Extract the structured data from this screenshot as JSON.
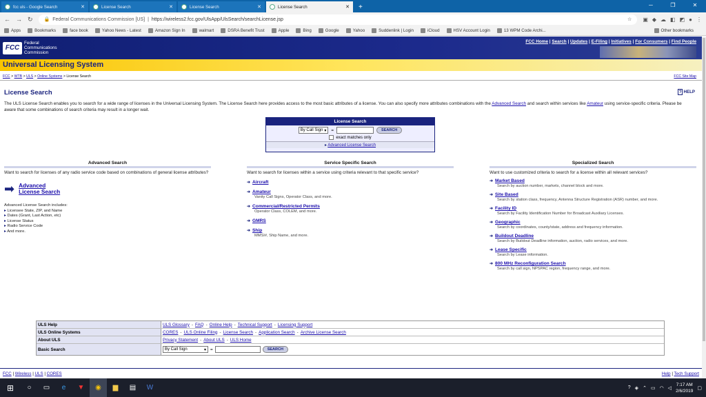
{
  "browser": {
    "tabs": [
      {
        "label": "fcc uls - Google Search",
        "active": false
      },
      {
        "label": "License Search",
        "active": false
      },
      {
        "label": "License Search",
        "active": false
      },
      {
        "label": "License Search",
        "active": true
      }
    ],
    "url_site": "Federal Communications Commission [US]",
    "url": "https://wireless2.fcc.gov/UlsApp/UlsSearch/searchLicense.jsp",
    "bookmarks": [
      "Apps",
      "Bookmarks",
      "face book",
      "Yahoo News - Latest",
      "Amazon Sign In",
      "walmart",
      "DSRA Benefit Trust",
      "Apple",
      "Bing",
      "Google",
      "Yahoo",
      "Suddenlink | Login",
      "iCloud",
      "HSV Account Login",
      "13 WPM Code Archi..."
    ],
    "other_bookmarks": "Other bookmarks"
  },
  "header": {
    "logo_mark": "FCC",
    "logo_name": [
      "Federal",
      "Communications",
      "Commission"
    ],
    "top_links": [
      "FCC Home",
      "Search",
      "Updates",
      "E-Filing",
      "Initiatives",
      "For Consumers",
      "Find People"
    ],
    "banner": "Universal Licensing System"
  },
  "breadcrumb": {
    "items": [
      "FCC",
      "WTB",
      "ULS",
      "Online Systems"
    ],
    "current": "License Search",
    "site_map": "FCC Site Map"
  },
  "main": {
    "title": "License Search",
    "help": "HELP",
    "help_mark": "?",
    "intro": {
      "before": "The ULS License Search enables you to search for a wide range of licenses in the Universal Licensing System. The License Search here provides access to the most basic attributes of a license. You can also specify more attributes combinations with the ",
      "link1": "Advanced Search",
      "middle": " and search within services like ",
      "link2": "Amateur",
      "after": " using service-specific criteria. Please be aware that some combinations of search criteria may result in a longer wait."
    },
    "search_box": {
      "title": "License Search",
      "select": "By Call Sign",
      "equals": "=",
      "button": "SEARCH",
      "exact": "exact matches only",
      "advanced": "Advanced License Search"
    }
  },
  "advanced": {
    "heading": "Advanced Search",
    "desc": "Want to search for licenses of any radio service code based on combinations of general license attributes?",
    "link": "Advanced License Search",
    "includes_title": "Advanced License Search includes:",
    "includes": [
      "Licensee State, ZIP, and Name",
      "Dates (Grant, Last Action, etc)",
      "License Status",
      "Radio Service Code",
      "And more."
    ]
  },
  "service": {
    "heading": "Service Specific Search",
    "desc": "Want to search for licenses within a service using criteria relevant to that specific service?",
    "items": [
      {
        "name": "Aircraft",
        "desc": ""
      },
      {
        "name": "Amateur",
        "desc": "Vanity Call Signs, Operator Class, and more."
      },
      {
        "name": "Commercial/Restricted Permits",
        "desc": "Operator Class, COLEM, and more."
      },
      {
        "name": "GMRS",
        "desc": ""
      },
      {
        "name": "Ship",
        "desc": "MMSI#, Ship Name, and more."
      }
    ]
  },
  "specialized": {
    "heading": "Specialized Search",
    "desc": "Want to use customized criteria to search for a license within all relevant services?",
    "items": [
      {
        "name": "Market Based",
        "desc": "Search by auction number, markets, channel block and more."
      },
      {
        "name": "Site Based",
        "desc": "Search by station class, frequency, Antenna Structure Registration (ASR) number, and more."
      },
      {
        "name": "Facility ID",
        "desc": "Search by Facility Identification Number for Broadcast Auxiliary Licenses."
      },
      {
        "name": "Geographic",
        "desc": "Search by coordinates, county/state, address and frequency information."
      },
      {
        "name": "Buildout Deadline",
        "desc": "Search by Buildout Deadline information, auction, radio services, and more."
      },
      {
        "name": "Lease Specific",
        "desc": "Search by Lease information."
      },
      {
        "name": "800 MHz Reconfiguration Search",
        "desc": "Search by call sign, NPSPAC region, frequency range, and more."
      }
    ]
  },
  "footer_table": {
    "rows": [
      {
        "key": "ULS Help",
        "links": [
          "ULS Glossary",
          "FAQ",
          "Online Help",
          "Technical Support",
          "Licensing Support"
        ]
      },
      {
        "key": "ULS Online Systems",
        "links": [
          "CORES",
          "ULS Online Filing",
          "License Search",
          "Application Search",
          "Archive License Search"
        ]
      },
      {
        "key": "About ULS",
        "links": [
          "Privacy Statement",
          "About ULS",
          "ULS Home"
        ]
      }
    ],
    "search": {
      "key": "Basic Search",
      "select": "By Call Sign",
      "equals": "=",
      "button": "SEARCH"
    }
  },
  "bottom": {
    "left": [
      "FCC",
      "Wireless",
      "ULS",
      "CORES"
    ],
    "right": [
      "Help",
      "Tech Support"
    ]
  },
  "taskbar": {
    "time": "7:17 AM",
    "date": "2/6/2019"
  }
}
